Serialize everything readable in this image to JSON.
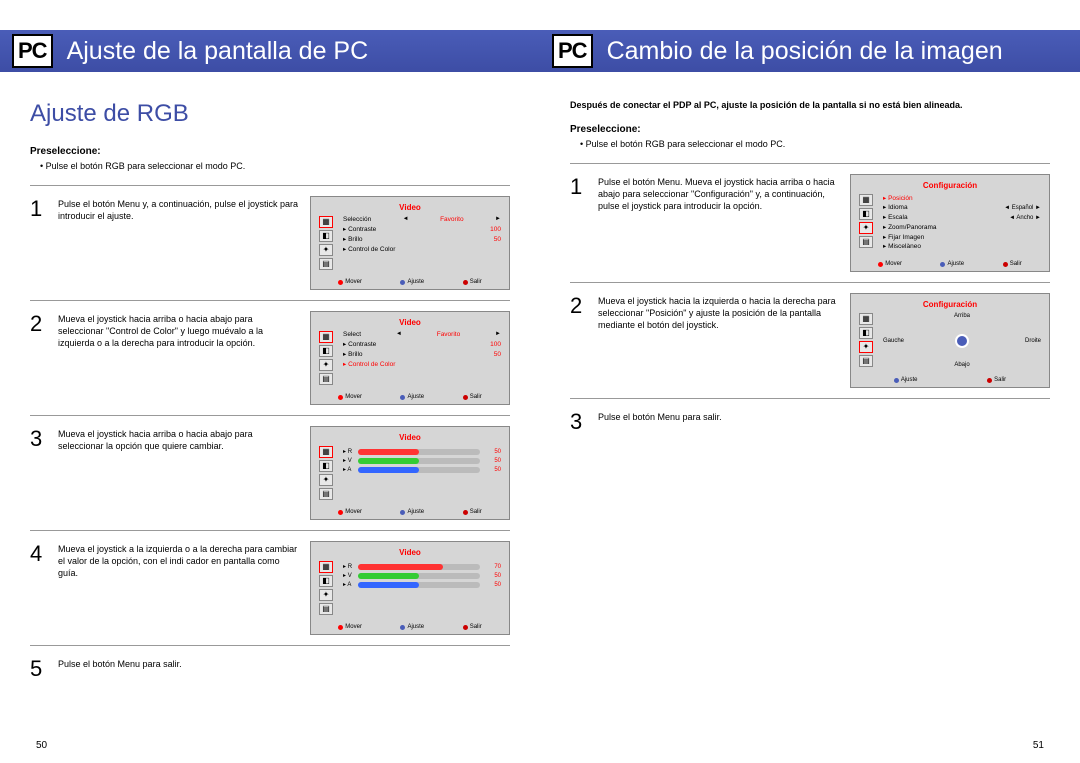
{
  "left": {
    "pc_badge": "PC",
    "header_title": "Ajuste de la pantalla de PC",
    "section_title": "Ajuste de RGB",
    "preselect_label": "Preseleccione:",
    "preselect_text": "Pulse el botón RGB para seleccionar el modo PC.",
    "steps": {
      "s1": {
        "num": "1",
        "text": "Pulse el botón Menu y, a continuación, pulse el joystick para introducir el ajuste."
      },
      "s2": {
        "num": "2",
        "text": "Mueva el joystick hacia arriba o hacia abajo para seleccionar \"Control de Color\" y luego muévalo a la izquierda o a la derecha para introducir la opción."
      },
      "s3": {
        "num": "3",
        "text": "Mueva el joystick hacia arriba o hacia abajo para seleccionar la opción que quiere cambiar."
      },
      "s4": {
        "num": "4",
        "text": "Mueva el joystick a la izquierda o a la derecha para cambiar el valor de la opción, con el indi cador en pantalla como guía."
      },
      "s5": {
        "num": "5",
        "text": "Pulse el botón Menu para salir."
      }
    },
    "osd": {
      "video_title": "Video",
      "sel_label": "Selección",
      "select_label": "Select",
      "fav_label": "Favorito",
      "contraste": "Contraste",
      "brillo": "Brillo",
      "control_color": "Control de Color",
      "val_100": "100",
      "val_50": "50",
      "val_70": "70",
      "rgb_r": "R",
      "rgb_v": "V",
      "rgb_a": "A",
      "footer_mover": "Mover",
      "footer_ajuste": "Ajuste",
      "footer_salir": "Salir"
    },
    "page_num": "50"
  },
  "right": {
    "pc_badge": "PC",
    "header_title": "Cambio de la posición de la imagen",
    "intro_text": "Después de conectar el PDP al PC, ajuste la posición de la pantalla si no está bien alineada.",
    "preselect_label": "Preseleccione:",
    "preselect_text": "Pulse el botón RGB para seleccionar el modo PC.",
    "steps": {
      "s1": {
        "num": "1",
        "text": "Pulse el botón Menu. Mueva el joystick hacia arriba o hacia abajo para seleccionar \"Configuración\" y, a continuación, pulse el joystick para introducir la opción."
      },
      "s2": {
        "num": "2",
        "text": "Mueva el joystick hacia la izquierda o hacia la derecha para seleccionar \"Posición\" y ajuste la posición de la pantalla mediante el botón del joystick."
      },
      "s3": {
        "num": "3",
        "text": "Pulse el botón Menu para salir."
      }
    },
    "osd": {
      "config_title": "Configuración",
      "posicion": "Posición",
      "idioma": "Idioma",
      "idioma_val": "Español",
      "escala": "Escala",
      "escala_val": "Ancho",
      "zoom": "Zoom/Panorama",
      "fijar": "Fijar Imagen",
      "misc": "Miscelàneo",
      "footer_mover": "Mover",
      "footer_ajuste": "Ajuste",
      "footer_salir": "Salir",
      "pos_arriba": "Arriba",
      "pos_abajo": "Abajo",
      "pos_gauche": "Gauche",
      "pos_droite": "Droite"
    },
    "page_num": "51"
  }
}
